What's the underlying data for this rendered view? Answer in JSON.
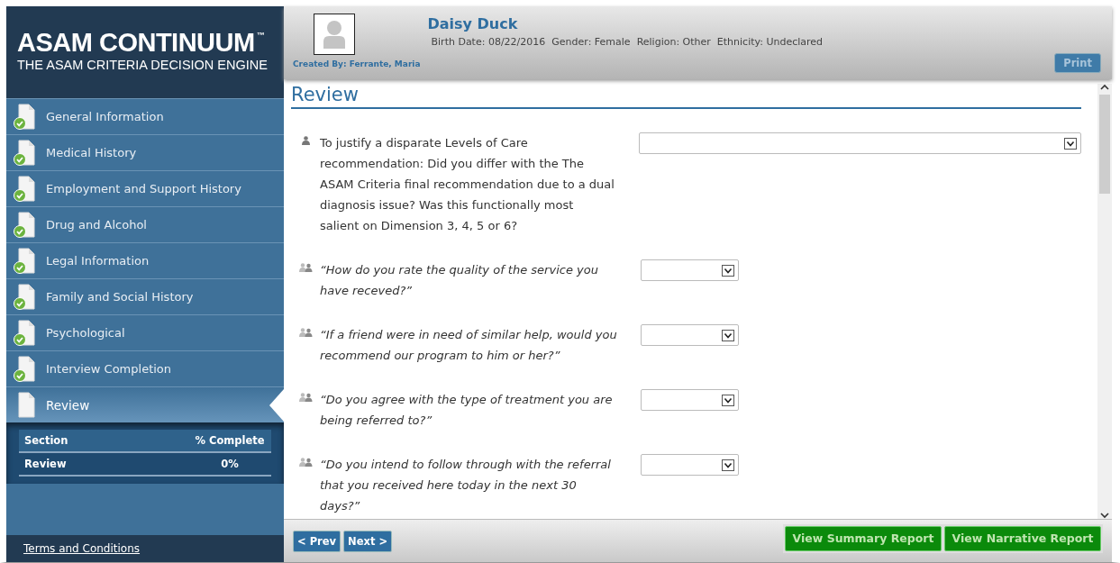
{
  "brand": {
    "title": "ASAM CONTINUUM",
    "trademark": "™",
    "subtitle": "THE ASAM CRITERIA DECISION ENGINE"
  },
  "nav": [
    {
      "label": "General Information",
      "completed": true,
      "selected": false
    },
    {
      "label": "Medical History",
      "completed": true,
      "selected": false
    },
    {
      "label": "Employment and Support History",
      "completed": true,
      "selected": false
    },
    {
      "label": "Drug and Alcohol",
      "completed": true,
      "selected": false
    },
    {
      "label": "Legal Information",
      "completed": true,
      "selected": false
    },
    {
      "label": "Family and Social History",
      "completed": true,
      "selected": false
    },
    {
      "label": "Psychological",
      "completed": true,
      "selected": false
    },
    {
      "label": "Interview Completion",
      "completed": true,
      "selected": false
    },
    {
      "label": "Review",
      "completed": false,
      "selected": true
    }
  ],
  "progress_table": {
    "columns": [
      "Section",
      "% Complete"
    ],
    "rows": [
      [
        "Review",
        "0%"
      ]
    ]
  },
  "footer_link": "Terms and Conditions",
  "patient": {
    "name": "Daisy Duck",
    "details": [
      "Birth Date: 08/22/2016",
      "Gender: Female",
      "Religion: Other",
      "Ethnicity: Undeclared"
    ],
    "created_by": "Created By: Ferrante, Maria"
  },
  "print_button": "Print",
  "page_title": "Review",
  "questions": [
    {
      "kind": "clinician",
      "text": "To justify a disparate Levels of Care recommendation: Did you differ with the The ASAM Criteria final recommendation due to a dual diagnosis issue? Was this functionally most salient on Dimension 3, 4, 5 or 6?"
    },
    {
      "kind": "patient",
      "text": "“How do you rate the quality of the service you have receved?”"
    },
    {
      "kind": "patient",
      "text": "“If a friend were in need of similar help, would you recommend our program to him or her?”"
    },
    {
      "kind": "patient",
      "text": "“Do you agree with the type of treatment you are being referred to?”"
    },
    {
      "kind": "patient",
      "text": "“Do you intend to follow through with the referral that you received here today in the next 30 days?”"
    }
  ],
  "nav_buttons": [
    "< Prev",
    "Next >"
  ],
  "report_buttons": [
    "View Summary Report",
    "View Narrative Report"
  ]
}
